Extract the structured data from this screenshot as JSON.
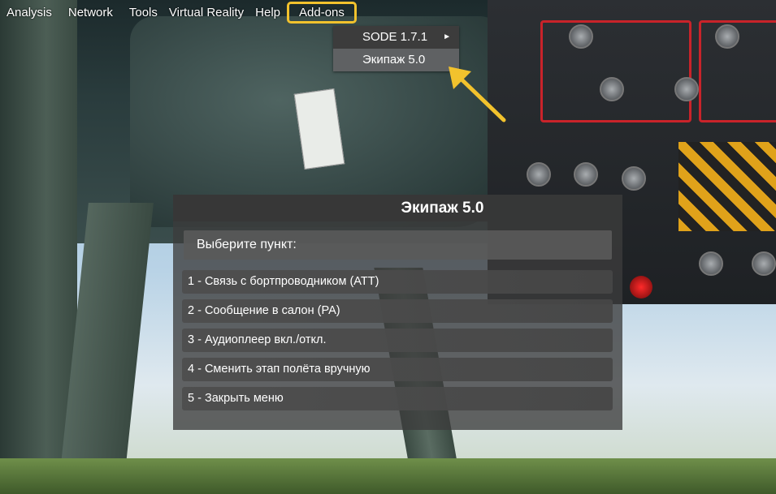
{
  "menubar": {
    "items": [
      {
        "label": "Analysis"
      },
      {
        "label": "Network"
      },
      {
        "label": "Tools"
      },
      {
        "label": "Virtual Reality"
      },
      {
        "label": "Help"
      },
      {
        "label": "Add-ons"
      }
    ]
  },
  "addons_menu": {
    "items": [
      {
        "label": "SODE 1.7.1",
        "submenu_arrow": "►"
      },
      {
        "label": "Экипаж 5.0"
      }
    ]
  },
  "crew_dialog": {
    "title": "Экипаж 5.0",
    "prompt": "Выберите пункт:",
    "options": [
      "1 - Связь с бортпроводником (ATT)",
      "2 - Сообщение в салон (PA)",
      "3 - Аудиоплеер вкл./откл.",
      "4 - Сменить этап полёта вручную",
      "5 - Закрыть меню"
    ]
  },
  "colors": {
    "highlight": "#f2c22d",
    "menu_bg": "#3c3c3c",
    "menu_hover": "#5f6163"
  }
}
